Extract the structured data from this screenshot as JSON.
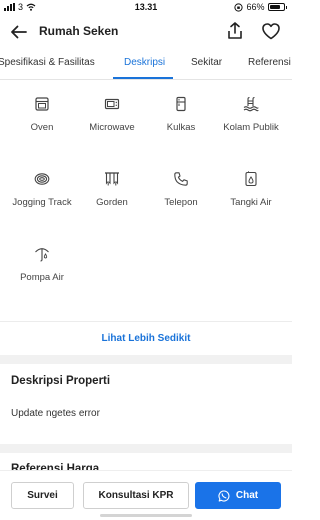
{
  "status_bar": {
    "carrier": "3",
    "time": "13.31",
    "battery": "66%"
  },
  "header": {
    "title": "Rumah Seken",
    "icons": [
      "back-arrow-icon",
      "share-icon",
      "heart-icon"
    ]
  },
  "tabs": [
    {
      "label": "Spesifikasi & Fasilitas"
    },
    {
      "label": "Deskripsi",
      "active": true
    },
    {
      "label": "Sekitar"
    },
    {
      "label": "Referensi"
    }
  ],
  "facilities": [
    {
      "label": "Oven",
      "icon": "oven-icon"
    },
    {
      "label": "Microwave",
      "icon": "microwave-icon"
    },
    {
      "label": "Kulkas",
      "icon": "fridge-icon"
    },
    {
      "label": "Kolam Publik",
      "icon": "pool-icon"
    },
    {
      "label": "Jogging Track",
      "icon": "jogging-track-icon"
    },
    {
      "label": "Gorden",
      "icon": "curtain-icon"
    },
    {
      "label": "Telepon",
      "icon": "phone-icon"
    },
    {
      "label": "Tangki Air",
      "icon": "water-tank-icon"
    },
    {
      "label": "Pompa Air",
      "icon": "water-pump-icon"
    }
  ],
  "toggle_link": "Lihat Lebih Sedikit",
  "description": {
    "title": "Deskripsi Properti",
    "text": "Update ngetes error"
  },
  "next_section": {
    "title": "Referensi Harga"
  },
  "actions": {
    "survei": "Survei",
    "kpr": "Konsultasi KPR",
    "chat": "Chat"
  },
  "colors": {
    "accent": "#1a73d9",
    "chat_button": "#1a73e8",
    "section_gap": "#f1f1f1"
  }
}
